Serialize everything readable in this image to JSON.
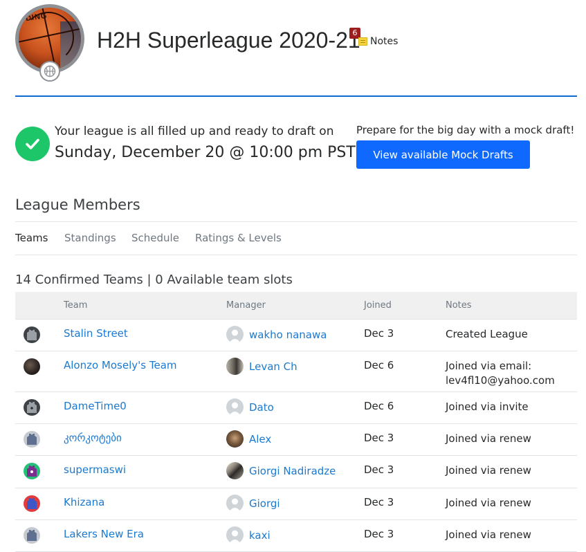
{
  "league": {
    "title": "H2H Superleague 2020-21",
    "notes_count": "6",
    "notes_label": "Notes",
    "logo_brand_text": "DING"
  },
  "draft": {
    "line1": "Your league is all filled up and ready to draft on",
    "line2": "Sunday, December 20 @ 10:00 pm PST",
    "mock_prompt": "Prepare for the big day with a mock draft!",
    "mock_button": "View available Mock Drafts"
  },
  "members": {
    "title": "League Members",
    "tabs": [
      "Teams",
      "Standings",
      "Schedule",
      "Ratings & Levels"
    ],
    "active_tab": "Teams",
    "count_text": "14 Confirmed Teams | 0 Available team slots"
  },
  "table": {
    "headers": [
      "Team",
      "Manager",
      "Joined",
      "Notes"
    ],
    "rows": [
      {
        "team": "Stalin Street",
        "jersey": "dark-gray",
        "manager": "wakho nanawa",
        "manager_avatar": "default",
        "joined": "Dec 3",
        "notes": "Created League"
      },
      {
        "team": "Alonzo Mosely's Team",
        "jersey": "photo",
        "manager": "Levan Ch",
        "manager_avatar": "photo",
        "joined": "Dec 6",
        "notes_line1": "Joined via email:",
        "notes_line2": "lev4fl10@yahoo.com"
      },
      {
        "team": "DameTime0",
        "jersey": "dark-gray",
        "manager": "Dato",
        "manager_avatar": "default",
        "joined": "Dec 6",
        "notes": "Joined via invite"
      },
      {
        "team": "კორკოტები",
        "jersey": "light-gray",
        "manager": "Alex",
        "manager_avatar": "photo",
        "joined": "Dec 3",
        "notes": "Joined via renew"
      },
      {
        "team": "supermaswi",
        "jersey": "green",
        "manager": "Giorgi Nadiradze",
        "manager_avatar": "photo",
        "joined": "Dec 3",
        "notes": "Joined via renew"
      },
      {
        "team": "Khizana",
        "jersey": "red",
        "manager": "Giorgi",
        "manager_avatar": "default",
        "joined": "Dec 3",
        "notes": "Joined via renew"
      },
      {
        "team": "Lakers New Era",
        "jersey": "light-gray",
        "manager": "kaxi",
        "manager_avatar": "default",
        "joined": "Dec 3",
        "notes": "Joined via renew"
      }
    ]
  },
  "colors": {
    "accent": "#0f69ff",
    "link": "#1a7ad1",
    "success": "#1ec66a",
    "rule": "#0f69d3",
    "badge": "#9b1d1d"
  },
  "icons": {
    "logo": "basketball-logo",
    "sport": "basketball-icon",
    "notes": "sticky-note-icon",
    "check": "checkmark-icon",
    "jersey": "jersey-icon",
    "avatar": "user-avatar-icon"
  }
}
